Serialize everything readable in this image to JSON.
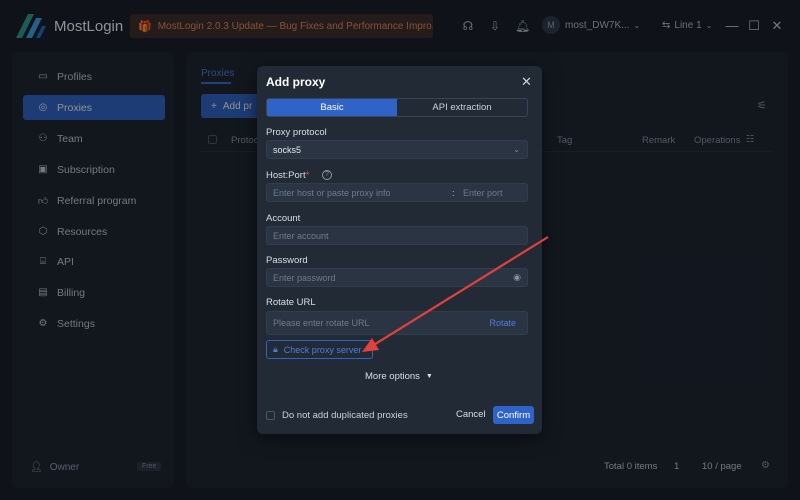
{
  "app": {
    "title": "MostLogin",
    "update_banner": "MostLogin 2.0.3 Update — Bug Fixes and Performance Impro...",
    "user_initial": "M",
    "user_name": "most_DW7K...",
    "line_label": "Line 1"
  },
  "icons": {
    "logo": "mostlogin-logo-icon",
    "banner": "gift-icon",
    "titlebar": [
      "support-icon",
      "download-icon",
      "bell-icon"
    ],
    "window": [
      "minimize-icon",
      "maximize-icon",
      "close-icon"
    ]
  },
  "sidebar": {
    "items": [
      {
        "label": "Profiles",
        "icon": "profile-icon",
        "active": false
      },
      {
        "label": "Proxies",
        "icon": "proxy-icon",
        "active": true
      },
      {
        "label": "Team",
        "icon": "team-icon",
        "active": false
      },
      {
        "label": "Subscription",
        "icon": "subscription-icon",
        "active": false
      },
      {
        "label": "Referral program",
        "icon": "thumbs-up-icon",
        "active": false
      },
      {
        "label": "Resources",
        "icon": "resources-icon",
        "active": false
      },
      {
        "label": "API",
        "icon": "api-icon",
        "active": false
      },
      {
        "label": "Billing",
        "icon": "billing-icon",
        "active": false
      },
      {
        "label": "Settings",
        "icon": "gear-icon",
        "active": false
      }
    ],
    "owner_label": "Owner",
    "plan_badge": "Free"
  },
  "main": {
    "tab": "Proxies",
    "add_button": "Add pr",
    "columns": [
      "Protoc",
      "Tag",
      "Remark",
      "Operations"
    ],
    "footer": {
      "total": "Total 0 items",
      "page": "1",
      "page_size": "10 / page"
    }
  },
  "dialog": {
    "title": "Add proxy",
    "segments": [
      "Basic",
      "API extraction"
    ],
    "active_segment": "Basic",
    "protocol": {
      "label": "Proxy protocol",
      "value": "socks5"
    },
    "host_port": {
      "label": "Host:Port",
      "required": "*",
      "host_placeholder": "Enter host or paste proxy info",
      "separator": ":",
      "port_placeholder": "Enter port"
    },
    "account": {
      "label": "Account",
      "placeholder": "Enter account"
    },
    "password": {
      "label": "Password",
      "placeholder": "Enter password"
    },
    "rotate_url": {
      "label": "Rotate URL",
      "placeholder": "Please enter rotate URL",
      "action": "Rotate"
    },
    "check_button": "Check proxy server",
    "more_options": "More options",
    "no_duplicates_label": "Do not add duplicated proxies",
    "cancel": "Cancel",
    "confirm": "Confirm"
  },
  "colors": {
    "accent": "#2f63c8",
    "link": "#4b7fe0",
    "banner_text": "#f08a52",
    "annotation_arrow": "#e0413f"
  }
}
